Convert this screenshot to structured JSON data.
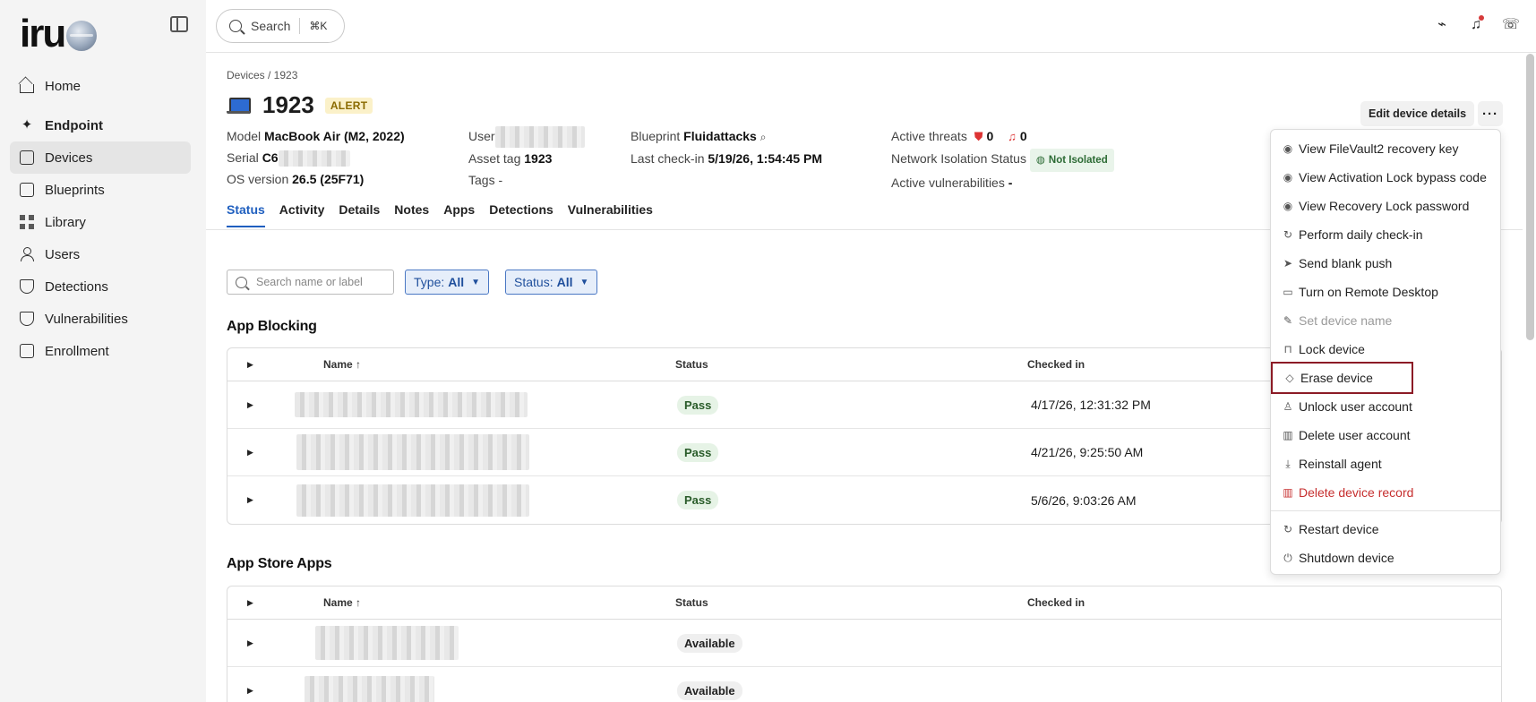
{
  "sidebar": {
    "logo": "iru",
    "items": [
      {
        "label": "Home",
        "icon": "home-icon"
      },
      {
        "label": "Endpoint",
        "icon": "endpoint-icon"
      },
      {
        "label": "Devices",
        "icon": "devices-icon"
      },
      {
        "label": "Blueprints",
        "icon": "blueprints-icon"
      },
      {
        "label": "Library",
        "icon": "library-icon"
      },
      {
        "label": "Users",
        "icon": "users-icon"
      },
      {
        "label": "Detections",
        "icon": "detections-icon"
      },
      {
        "label": "Vulnerabilities",
        "icon": "vulnerabilities-icon"
      },
      {
        "label": "Enrollment",
        "icon": "enrollment-icon"
      }
    ]
  },
  "topbar": {
    "search_label": "Search",
    "shortcut": "⌘K"
  },
  "breadcrumb": "Devices / 1923",
  "device": {
    "name": "1923",
    "badge": "ALERT",
    "model_label": "Model",
    "model": "MacBook Air (M2, 2022)",
    "serial_label": "Serial",
    "serial_prefix": "C6",
    "os_label": "OS version",
    "os": "26.5 (25F71)",
    "user_label": "User",
    "asset_label": "Asset tag",
    "asset": "1923",
    "tags_label": "Tags",
    "tags": "-",
    "blueprint_label": "Blueprint",
    "blueprint": "Fluidattacks",
    "checkin_label": "Last check-in",
    "checkin": "5/19/26, 1:54:45 PM",
    "threats_label": "Active threats",
    "threats_count": "0",
    "alerts_count": "0",
    "isolation_label": "Network Isolation Status",
    "isolation": "Not Isolated",
    "vulns_label": "Active vulnerabilities",
    "vulns": "-"
  },
  "actions": {
    "edit": "Edit device details",
    "more": "···"
  },
  "tabs": [
    "Status",
    "Activity",
    "Details",
    "Notes",
    "Apps",
    "Detections",
    "Vulnerabilities"
  ],
  "filters": {
    "search_placeholder": "Search name or label",
    "type_label": "Type:",
    "type_value": "All",
    "status_label": "Status:",
    "status_value": "All"
  },
  "app_blocking": {
    "title": "App Blocking",
    "headers": {
      "name": "Name ↑",
      "status": "Status",
      "checked": "Checked in"
    },
    "rows": [
      {
        "status": "Pass",
        "checked": "4/17/26, 12:31:32 PM"
      },
      {
        "status": "Pass",
        "checked": "4/21/26, 9:25:50 AM"
      },
      {
        "status": "Pass",
        "checked": "5/6/26, 9:03:26 AM"
      }
    ]
  },
  "app_store": {
    "title": "App Store Apps",
    "headers": {
      "name": "Name ↑",
      "status": "Status",
      "checked": "Checked in"
    },
    "rows": [
      {
        "status": "Available"
      },
      {
        "status": "Available"
      }
    ]
  },
  "menu": {
    "items": [
      {
        "label": "View FileVault2 recovery key",
        "icon": "eye-icon"
      },
      {
        "label": "View Activation Lock bypass code",
        "icon": "eye-icon"
      },
      {
        "label": "View Recovery Lock password",
        "icon": "eye-icon"
      },
      {
        "label": "Perform daily check-in",
        "icon": "refresh-icon"
      },
      {
        "label": "Send blank push",
        "icon": "send-icon"
      },
      {
        "label": "Turn on Remote Desktop",
        "icon": "monitor-icon"
      },
      {
        "label": "Set device name",
        "icon": "pencil-icon"
      },
      {
        "label": "Lock device",
        "icon": "lock-icon"
      },
      {
        "label": "Erase device",
        "icon": "eraser-icon"
      },
      {
        "label": "Unlock user account",
        "icon": "user-icon"
      },
      {
        "label": "Delete user account",
        "icon": "trash-icon"
      },
      {
        "label": "Reinstall agent",
        "icon": "download-icon"
      },
      {
        "label": "Delete device record",
        "icon": "trash-icon"
      },
      {
        "label": "Restart device",
        "icon": "restart-icon"
      },
      {
        "label": "Shutdown device",
        "icon": "power-icon"
      }
    ]
  },
  "colors": {
    "accent": "#1f5fbf",
    "danger": "#c62f2f",
    "highlight": "#8c1b26"
  }
}
